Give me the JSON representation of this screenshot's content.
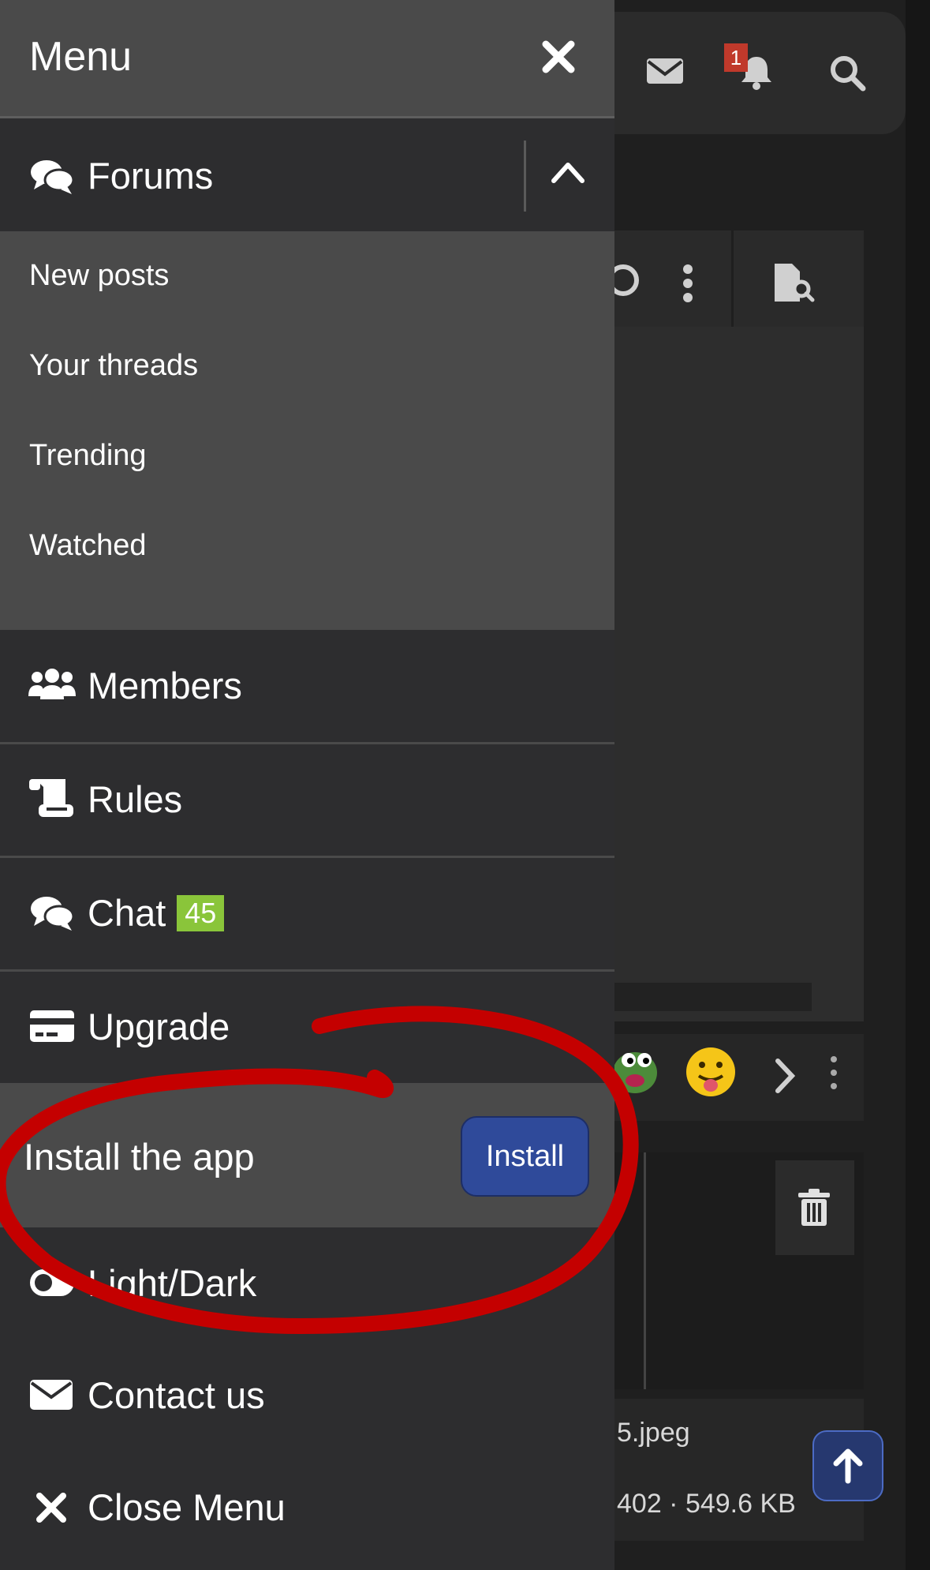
{
  "menu": {
    "title": "Menu",
    "forums_label": "Forums",
    "forum_subitems": [
      {
        "label": "New posts"
      },
      {
        "label": "Your threads"
      },
      {
        "label": "Trending"
      },
      {
        "label": "Watched"
      }
    ],
    "members_label": "Members",
    "rules_label": "Rules",
    "chat_label": "Chat",
    "chat_badge": "45",
    "upgrade_label": "Upgrade",
    "install_label": "Install the app",
    "install_button": "Install",
    "lightdark_label": "Light/Dark",
    "contact_label": "Contact us",
    "close_label": "Close Menu"
  },
  "background": {
    "notification_count": "1",
    "file_name": "5.jpeg",
    "file_meta": "402 · 549.6 KB"
  },
  "colors": {
    "menu_bg": "#2d2d2f",
    "submenu_bg": "#4a4a4a",
    "install_button": "#2f4a9a",
    "badge_green": "#8ac53a",
    "notification_red": "#c0392b",
    "annotation_red": "#c40000"
  },
  "icons": {
    "close": "close-icon",
    "forums": "comments-icon",
    "chevron": "chevron-up-icon",
    "members": "users-icon",
    "rules": "scroll-icon",
    "chat": "comments-icon",
    "upgrade": "credit-card-icon",
    "lightdark": "toggle-icon",
    "contact": "envelope-icon",
    "close_menu": "x-icon"
  }
}
